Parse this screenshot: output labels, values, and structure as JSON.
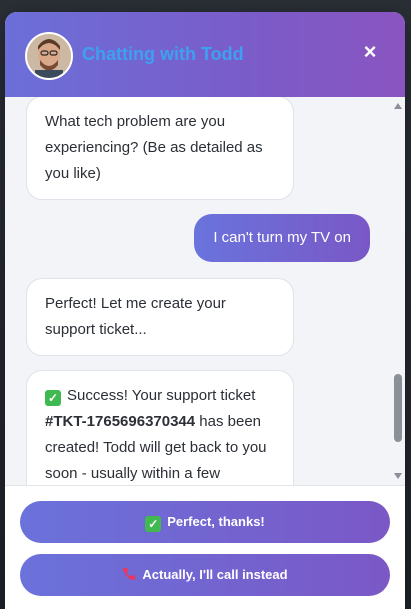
{
  "header": {
    "title": "Chatting with Todd",
    "close_label": "×"
  },
  "messages": [
    {
      "role": "bot",
      "text": "What tech problem are you experiencing? (Be as detailed as you like)"
    },
    {
      "role": "user",
      "text": "I can't turn my TV on"
    },
    {
      "role": "bot",
      "text": "Perfect! Let me create your support ticket..."
    },
    {
      "role": "bot",
      "prefix": "Success! Your support ticket",
      "ticket_id": "#TKT-1765696370344",
      "suffix": "has been created! Todd will get back to you soon - usually within a few"
    }
  ],
  "actions": {
    "confirm_label": "Perfect, thanks!",
    "call_label": "Actually, I'll call instead"
  },
  "icons": {
    "avatar": "avatar-photo",
    "check": "check-mark-icon",
    "phone": "phone-icon",
    "close": "close-icon"
  },
  "colors": {
    "header_gradient_start": "#6c6fd8",
    "header_gradient_end": "#8a55c0",
    "title_color": "#3ea0f0",
    "check_green": "#3fb950"
  }
}
